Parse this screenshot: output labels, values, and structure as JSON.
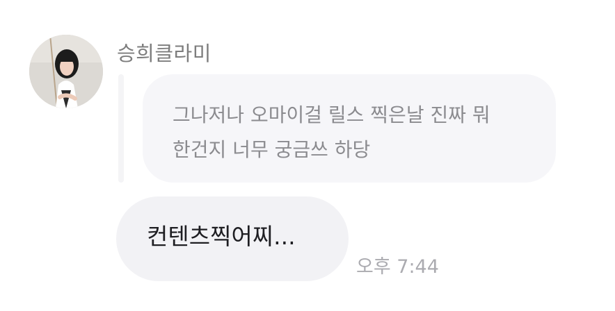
{
  "message_group": {
    "sender": {
      "name": "승희클라미",
      "avatar_icon": "profile-photo"
    },
    "reply_preview": {
      "lines": [
        "그나저나 오마이걸 릴스 찍은날 진짜 뭐",
        "한건지 너무 궁금쓰 하당"
      ]
    },
    "message": {
      "text": "컨텐츠찍어찌...",
      "time": "오후 7:44"
    }
  },
  "colors": {
    "background": "#ffffff",
    "reply_bubble": "#f6f6f9",
    "reply_bar": "#f4f4f6",
    "message_bubble": "#f2f2f5",
    "sender_name": "#7d7d7d",
    "reply_text": "#8b8b8f",
    "message_text": "#1e1e22",
    "timestamp": "#ababb0"
  }
}
